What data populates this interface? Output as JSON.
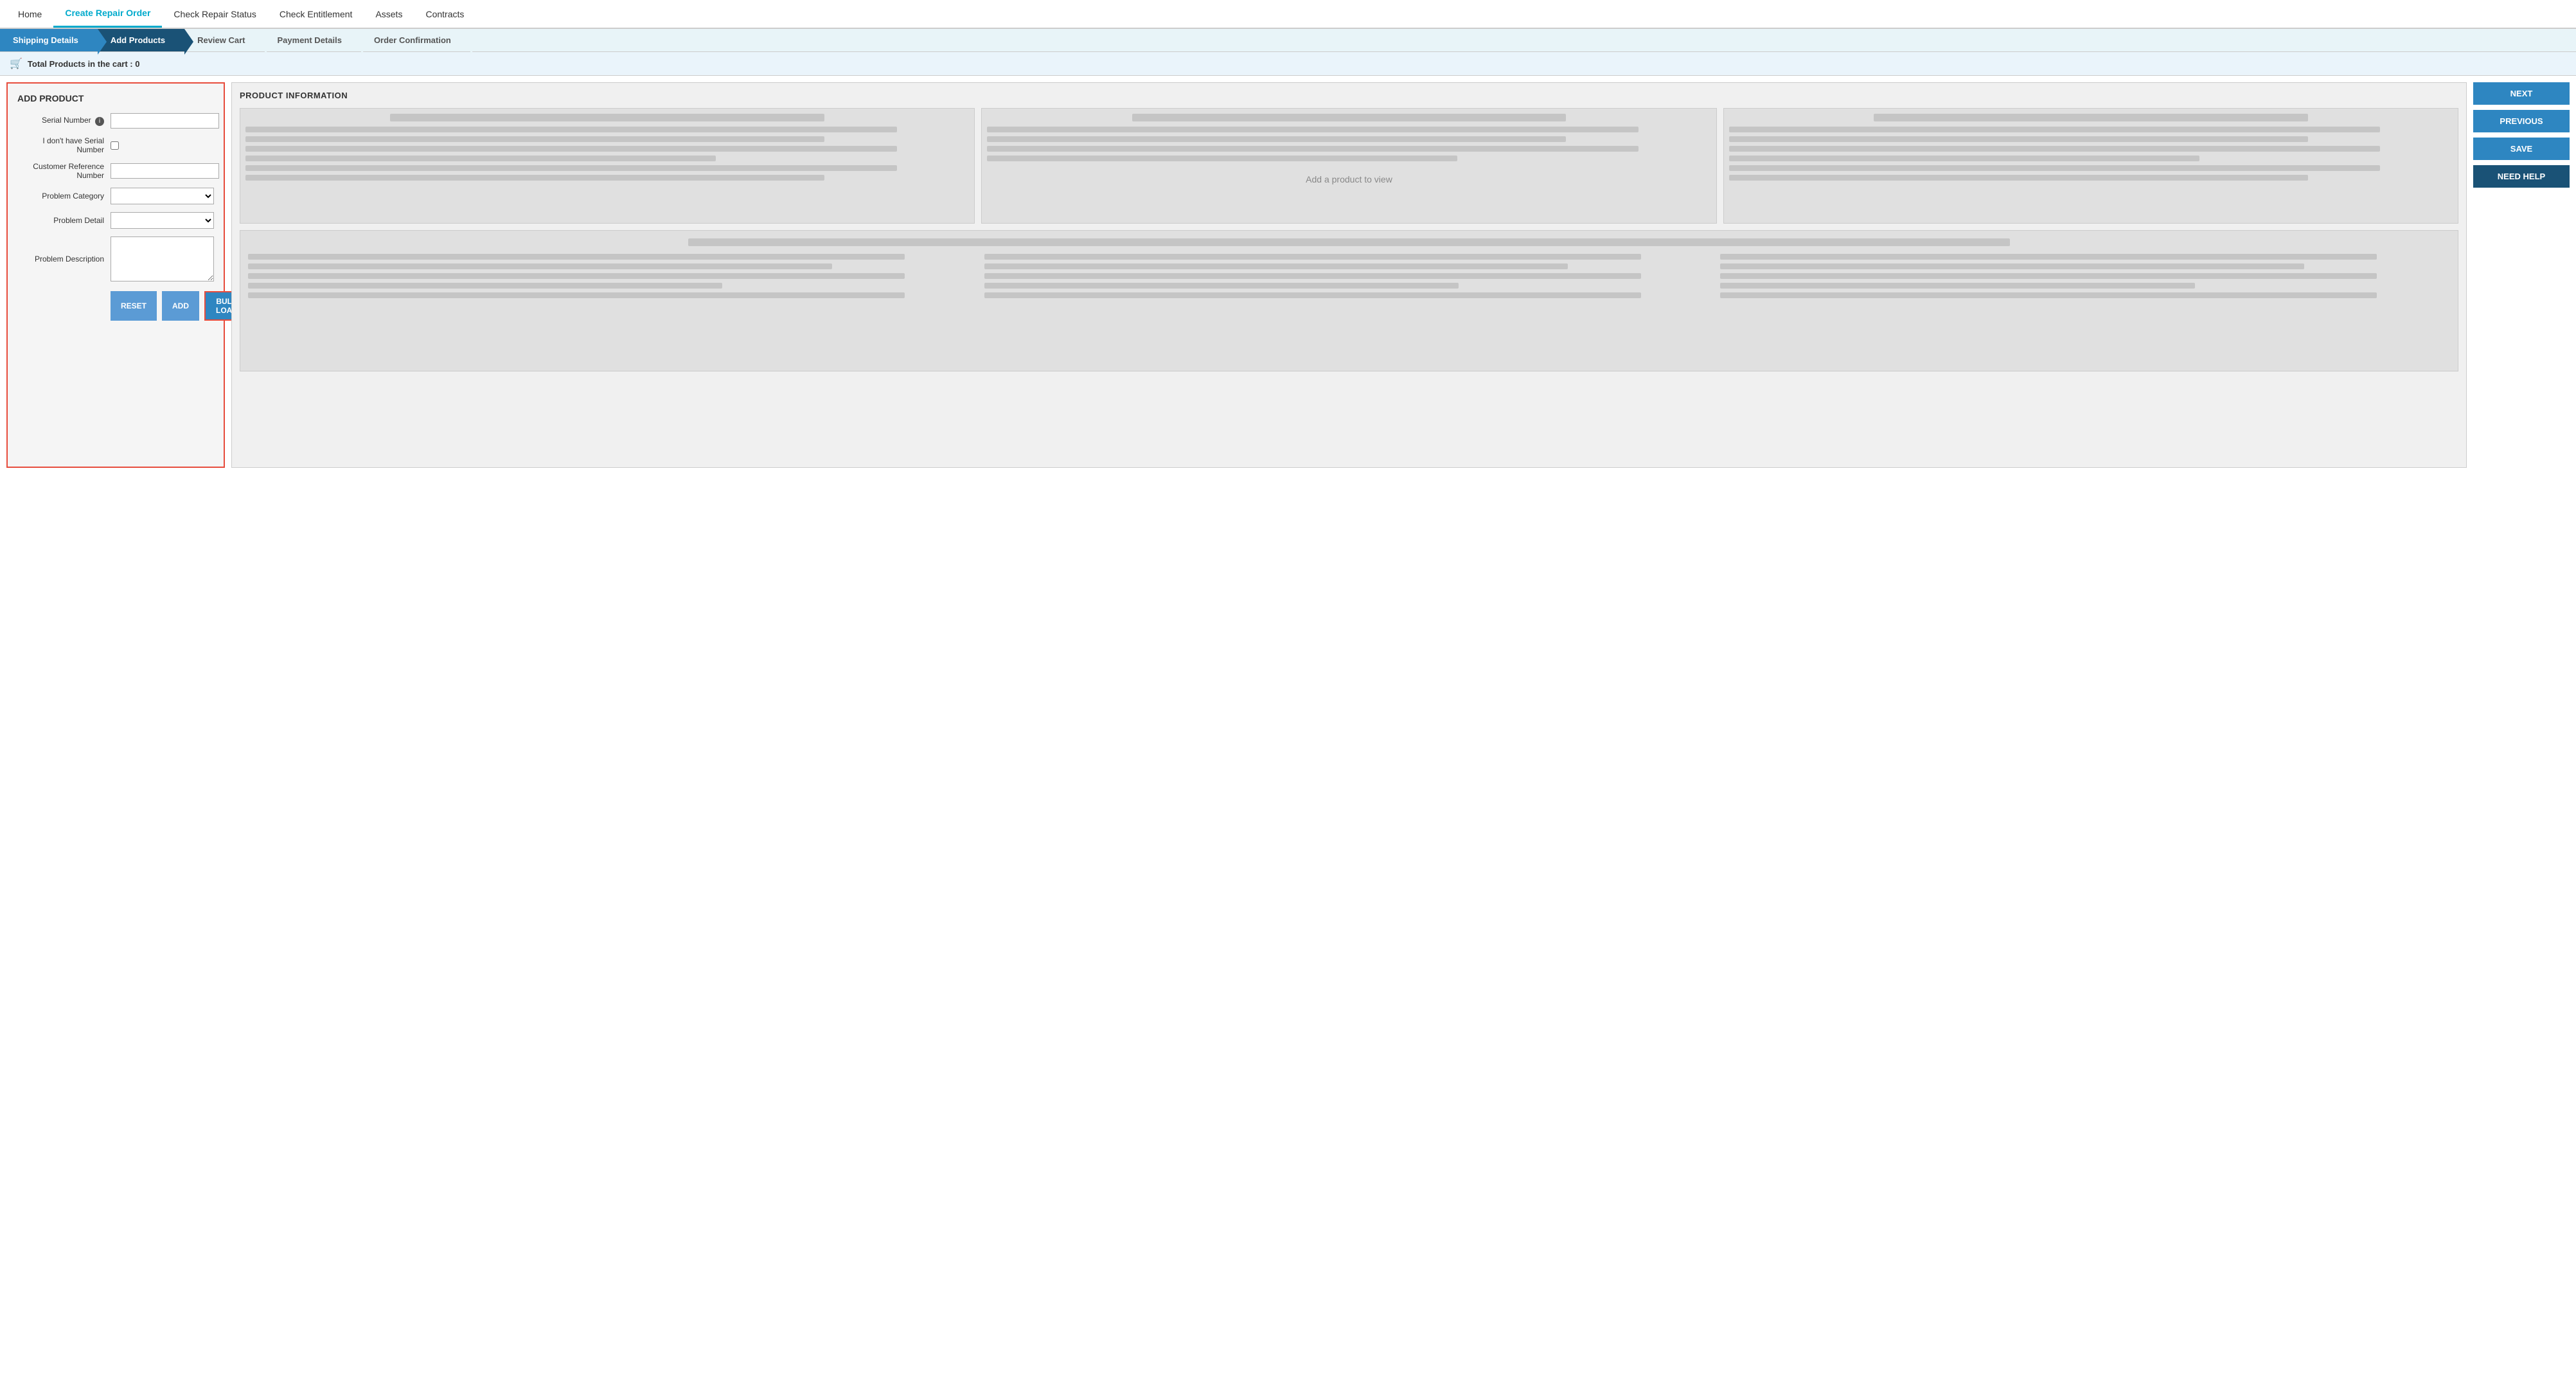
{
  "nav": {
    "items": [
      {
        "label": "Home",
        "active": false
      },
      {
        "label": "Create Repair Order",
        "active": true
      },
      {
        "label": "Check Repair Status",
        "active": false
      },
      {
        "label": "Check Entitlement",
        "active": false
      },
      {
        "label": "Assets",
        "active": false
      },
      {
        "label": "Contracts",
        "active": false
      }
    ]
  },
  "steps": [
    {
      "label": "Shipping Details",
      "state": "prev"
    },
    {
      "label": "Add Products",
      "state": "active"
    },
    {
      "label": "Review Cart",
      "state": "inactive"
    },
    {
      "label": "Payment Details",
      "state": "inactive"
    },
    {
      "label": "Order Confirmation",
      "state": "inactive"
    }
  ],
  "cart": {
    "label": "Total Products in the cart : 0"
  },
  "add_product": {
    "title": "ADD PRODUCT",
    "serial_number_label": "Serial Number",
    "no_serial_label": "I don't have Serial Number",
    "customer_ref_label": "Customer Reference Number",
    "problem_category_label": "Problem Category",
    "problem_detail_label": "Problem Detail",
    "problem_desc_label": "Problem Description",
    "reset_label": "RESET",
    "add_label": "ADD",
    "bulk_load_label": "BULK LOAD"
  },
  "product_info": {
    "title": "PRODUCT INFORMATION",
    "placeholder_message": "Add a product to view"
  },
  "actions": {
    "next_label": "NEXT",
    "previous_label": "PREVIOUS",
    "save_label": "SAVE",
    "need_help_label": "NEED HELP"
  }
}
